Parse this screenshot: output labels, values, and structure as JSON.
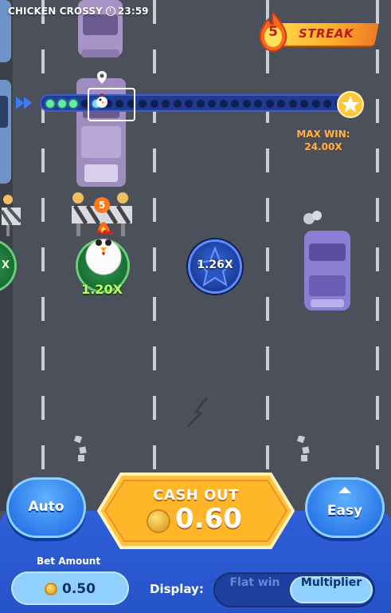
{
  "header": {
    "title": "CHICKEN CROSSY",
    "time": "23:59"
  },
  "streak": {
    "count": "5",
    "label": "STREAK"
  },
  "progress": {
    "completed": 3,
    "total": 26,
    "current_index": 4
  },
  "max_win": {
    "line1": "MAX WIN:",
    "line2": "24.00X"
  },
  "lanes": {
    "current_label": "1.20X",
    "next_label": "1.26X",
    "side_label": "X"
  },
  "chicken_streak_badge": "5",
  "controls": {
    "auto_label": "Auto",
    "cashout_title": "CASH OUT",
    "cashout_value": "0.60",
    "difficulty_label": "Easy",
    "bet_amount_label": "Bet Amount",
    "bet_amount_value": "0.50",
    "display_label": "Display:",
    "display_options": [
      "Flat win",
      "Multiplier"
    ],
    "display_selected": "Multiplier"
  },
  "colors": {
    "road": "#4c505b",
    "panel": "#2f5fd8",
    "cashout": "#ffc23a",
    "streak": "#ffb02a",
    "accent_green": "#b6ff6b"
  }
}
